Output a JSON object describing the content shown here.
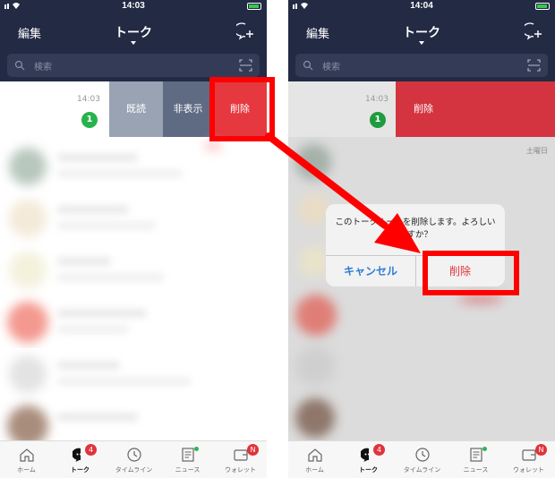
{
  "status": {
    "left_time": "14:03",
    "right_time": "14:04"
  },
  "nav": {
    "edit_label": "編集",
    "title": "トーク"
  },
  "search": {
    "placeholder": "検索"
  },
  "swiped_row": {
    "time": "14:03",
    "unread_count": "1",
    "actions": {
      "read": "既読",
      "hide": "非表示",
      "delete": "削除"
    }
  },
  "right_list": {
    "day_label": "土曜日"
  },
  "dialog": {
    "message": "このトークルームを削除します。よろしいですか？",
    "cancel_label": "キャンセル",
    "delete_label": "削除"
  },
  "tabs": [
    {
      "label": "ホーム",
      "icon": "home-icon"
    },
    {
      "label": "トーク",
      "icon": "chat-icon",
      "badge": "4"
    },
    {
      "label": "タイムライン",
      "icon": "clock-icon"
    },
    {
      "label": "ニュース",
      "icon": "news-icon"
    },
    {
      "label": "ウォレット",
      "icon": "wallet-icon",
      "badge": "N"
    }
  ],
  "colors": {
    "navbar": "#232a44",
    "delete": "#e5383f",
    "read": "#9aa3b4",
    "hide": "#5f6a83",
    "unread_badge": "#26b34b",
    "highlight": "#ff0000"
  }
}
